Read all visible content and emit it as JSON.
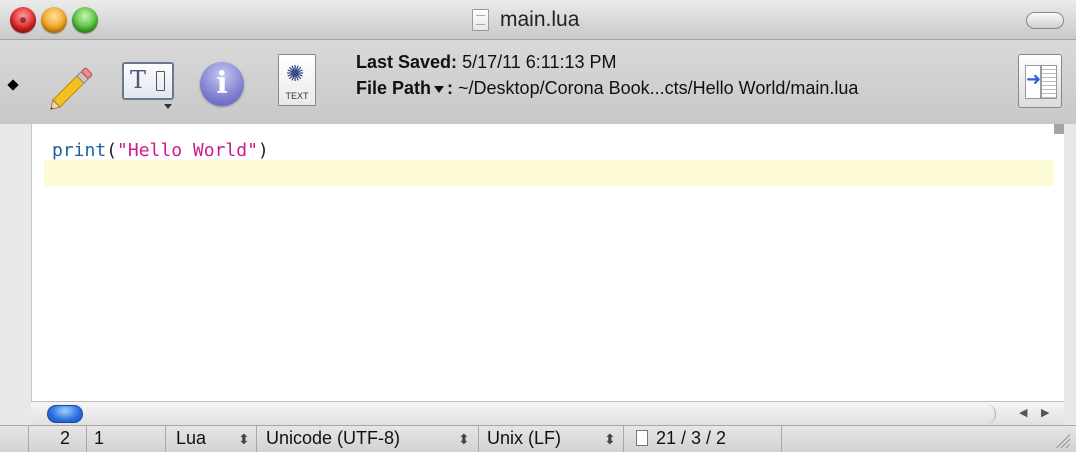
{
  "window": {
    "title": "main.lua"
  },
  "toolbar": {
    "last_saved_label": "Last Saved:",
    "last_saved_value": "5/17/11 6:11:13 PM",
    "file_path_label": "File Path",
    "file_path_sep": ":",
    "file_path_value": "~/Desktop/Corona Book...cts/Hello World/main.lua",
    "text_doc_label": "TEXT",
    "info_glyph": "i",
    "text_tool_glyph": "T"
  },
  "editor": {
    "line1_func": "print",
    "line1_open": "(",
    "line1_string": "\"Hello World\"",
    "line1_close": ")"
  },
  "statusbar": {
    "line": "2",
    "column": "1",
    "language": "Lua",
    "encoding": "Unicode (UTF-8)",
    "line_endings": "Unix (LF)",
    "doc_stats": "21 / 3 / 2"
  },
  "icons": [
    "close-button",
    "minimize-button",
    "zoom-button",
    "document-icon",
    "pencil-icon",
    "text-options-icon",
    "info-icon",
    "text-document-icon",
    "navigate-icon"
  ]
}
